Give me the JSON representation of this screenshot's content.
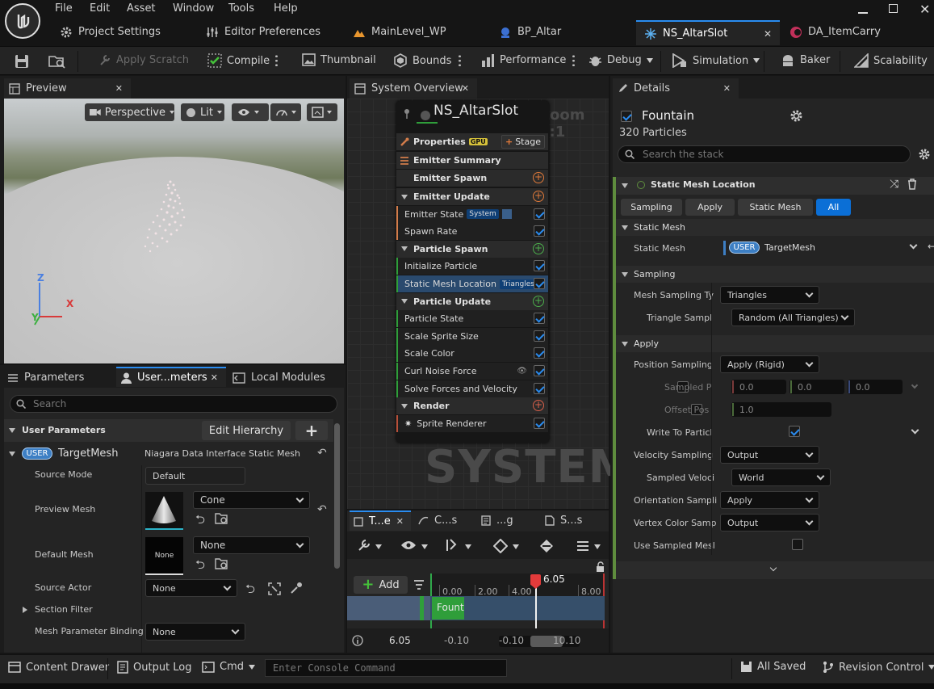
{
  "menu": [
    "File",
    "Edit",
    "Asset",
    "Window",
    "Tools",
    "Help"
  ],
  "doc_tabs": [
    {
      "label": "Project Settings",
      "icon": "settings-icon"
    },
    {
      "label": "Editor Preferences",
      "icon": "sliders-icon"
    },
    {
      "label": "MainLevel_WP",
      "icon": "level-icon"
    },
    {
      "label": "BP_Altar",
      "icon": "blueprint-icon"
    },
    {
      "label": "NS_AltarSlot",
      "icon": "niagara-icon",
      "active": true
    },
    {
      "label": "DA_ItemCarry",
      "icon": "data-asset-icon"
    }
  ],
  "toolbar": {
    "apply_scratch": "Apply Scratch",
    "compile": "Compile",
    "thumbnail": "Thumbnail",
    "bounds": "Bounds",
    "performance": "Performance",
    "debug": "Debug",
    "simulation": "Simulation",
    "baker": "Baker",
    "scalability": "Scalability"
  },
  "preview": {
    "tab": "Preview",
    "perspective": "Perspective",
    "lit": "Lit",
    "axis_x": "X",
    "axis_y": "Y",
    "axis_z": "Z"
  },
  "system_overview": {
    "tab": "System Overview",
    "system_name": "NS_AltarSlot",
    "zoom": "Zoom 1:1",
    "watermark": "SYSTEM",
    "properties": "Properties",
    "gpu": "GPU",
    "stage": "Stage",
    "emitter_summary": "Emitter Summary",
    "items": [
      {
        "label": "Emitter Spawn",
        "type": "header-sub",
        "plus": "orange"
      },
      {
        "label": "Emitter Update",
        "type": "header",
        "plus": "orange"
      },
      {
        "label": "Emitter State",
        "type": "item",
        "tag": "System",
        "extra": true
      },
      {
        "label": "Spawn Rate",
        "type": "item"
      },
      {
        "label": "Particle Spawn",
        "type": "header",
        "plus": "green"
      },
      {
        "label": "Initialize Particle",
        "type": "item"
      },
      {
        "label": "Static Mesh Location",
        "type": "item",
        "tag": "Triangles",
        "selected": true
      },
      {
        "label": "Particle Update",
        "type": "header",
        "plus": "green"
      },
      {
        "label": "Particle State",
        "type": "item"
      },
      {
        "label": "Scale Sprite Size",
        "type": "item"
      },
      {
        "label": "Scale Color",
        "type": "item"
      },
      {
        "label": "Curl Noise Force",
        "type": "item",
        "eye": true
      },
      {
        "label": "Solve Forces and Velocity",
        "type": "item"
      },
      {
        "label": "Render",
        "type": "header",
        "plus": "red"
      },
      {
        "label": "Sprite Renderer",
        "type": "item",
        "sprite": true
      }
    ]
  },
  "parameters": {
    "tabs": [
      "Parameters",
      "User...meters",
      "Local Modules"
    ],
    "search_placeholder": "Search",
    "user_parameters": "User Parameters",
    "edit_hierarchy": "Edit Hierarchy",
    "user_badge": "USER",
    "target_mesh": "TargetMesh",
    "target_mesh_type": "Niagara Data Interface Static Mesh",
    "rows": {
      "source_mode": {
        "label": "Source Mode",
        "value": "Default"
      },
      "preview_mesh": {
        "label": "Preview Mesh",
        "value": "Cone"
      },
      "default_mesh": {
        "label": "Default Mesh",
        "value": "None",
        "thumb": "None"
      },
      "source_actor": {
        "label": "Source Actor",
        "value": "None"
      },
      "section_filter": {
        "label": "Section Filter"
      },
      "mesh_param_binding": {
        "label": "Mesh Parameter Binding",
        "value": "None"
      }
    }
  },
  "timeline": {
    "tabs": [
      "T...e",
      "C...s",
      "...g",
      "S...s"
    ],
    "add": "Add",
    "playhead": "6.05",
    "ticks": [
      "0.00",
      "2.00",
      "4.00",
      "8.00"
    ],
    "track": "Fount",
    "current": "6.05",
    "range_start": "-0.10",
    "range_a": "-0.10",
    "range_b": "10.10"
  },
  "details": {
    "tab": "Details",
    "emitter": "Fountain",
    "particles": "320 Particles",
    "search_placeholder": "Search the stack",
    "module": "Static Mesh Location",
    "filters": [
      "Sampling",
      "Apply",
      "Static Mesh",
      "All"
    ],
    "sections": {
      "static_mesh": "Static Mesh",
      "sampling": "Sampling",
      "apply": "Apply"
    },
    "static_mesh_label": "Static Mesh",
    "user_badge": "USER",
    "target_mesh": "TargetMesh",
    "mesh_sampling_type": {
      "label": "Mesh Sampling Ty",
      "value": "Triangles"
    },
    "triangle_sampling": {
      "label": "Triangle Sampl",
      "value": "Random (All Triangles)"
    },
    "position_sampling": {
      "label": "Position Sampling",
      "value": "Apply (Rigid)"
    },
    "sampled_position": {
      "label": "Sampled P",
      "x": "0.0",
      "y": "0.0",
      "z": "0.0"
    },
    "offset_position": {
      "label": "Offset Pos",
      "value": "1.0"
    },
    "write_to_particle": {
      "label": "Write To Particl"
    },
    "velocity_sampling": {
      "label": "Velocity Sampling",
      "value": "Output"
    },
    "sampled_velocity": {
      "label": "Sampled Veloci",
      "value": "World"
    },
    "orientation_sampling": {
      "label": "Orientation Sampli",
      "value": "Apply"
    },
    "vertex_color": {
      "label": "Vertex Color Samp",
      "value": "Output"
    },
    "use_sampled_mesh": {
      "label": "Use Sampled Mesl"
    }
  },
  "statusbar": {
    "content_drawer": "Content Drawer",
    "output_log": "Output Log",
    "cmd": "Cmd",
    "console_placeholder": "Enter Console Command",
    "all_saved": "All Saved",
    "revision_control": "Revision Control"
  },
  "colors": {
    "accent": "#2a8cf0",
    "niagara_blue": "#0b6fd6",
    "user_badge": "#3d7fc4",
    "green": "#2f9e3a",
    "orange": "#e07a3a",
    "playhead": "#e33b3b"
  }
}
